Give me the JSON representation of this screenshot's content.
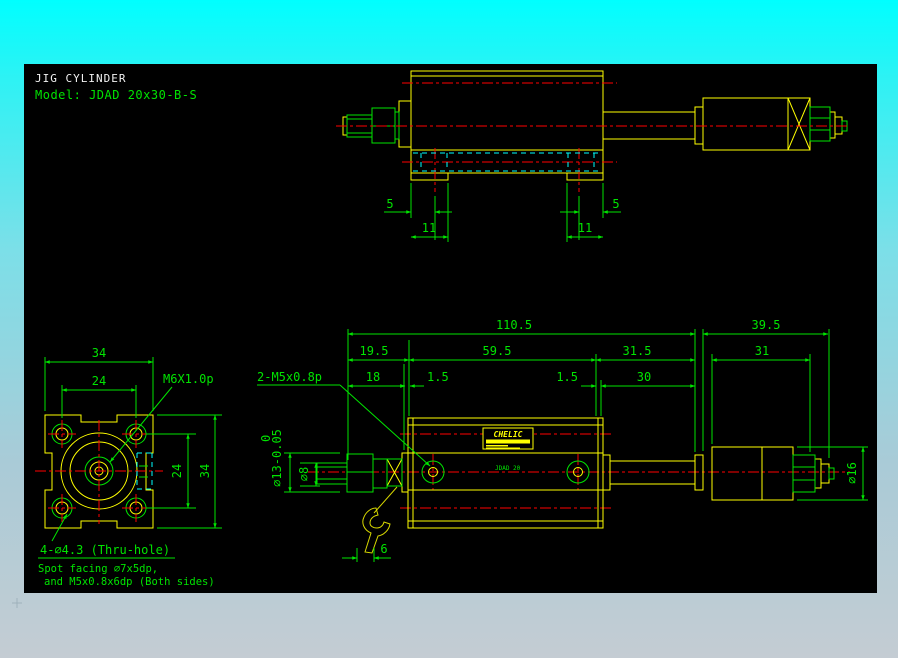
{
  "title": "JIG CYLINDER",
  "model": "Model: JDAD 20x30-B-S",
  "colors": {
    "background_top": "#00ffff",
    "background_bottom": "#c4ccd3",
    "canvas": "#000000",
    "geometry": "#ffff00",
    "dimension": "#00e400",
    "centerline": "#ff0000",
    "hidden": "#00ffff",
    "title_text": "#f2f2f2"
  },
  "top_view": {
    "d5_left": "5",
    "d11_left": "11",
    "d11_right": "11",
    "d5_right": "5"
  },
  "front_view": {
    "d34_top": "34",
    "d24_top": "24",
    "d24_right": "24",
    "d34_right": "34",
    "thread_label": "M6X1.0p",
    "holes_label": "4-∅4.3 (Thru-hole)",
    "note_line1": "Spot facing ∅7x5dp,",
    "note_line2": "and M5x0.8x6dp (Both sides)"
  },
  "main_view": {
    "d110_5": "110.5",
    "d39_5": "39.5",
    "d19_5": "19.5",
    "d59_5": "59.5",
    "d31_5": "31.5",
    "d31": "31",
    "d18": "18",
    "d1_5_left": "1.5",
    "d1_5_right": "1.5",
    "d30": "30",
    "port_label": "2-M5x0.8p",
    "rod_dia_label": "∅13-0.05",
    "rod_dia_tol_upper": "0",
    "thread_dia_label": "∅8",
    "shock_dia_label": "∅16",
    "wrench_flats": "6",
    "brand_label": "CHELIC",
    "body_marking": "JDAD 20"
  }
}
